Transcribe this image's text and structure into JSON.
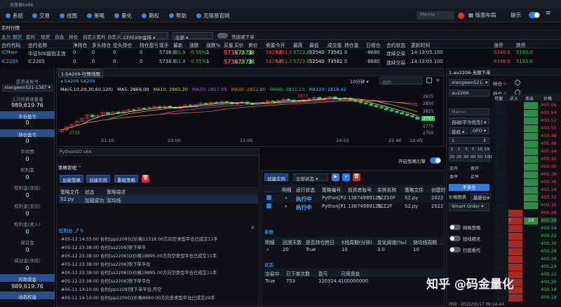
{
  "window": {
    "title": "无限易Kx64"
  },
  "menu": {
    "items": [
      {
        "label": "系统"
      },
      {
        "label": "交易"
      },
      {
        "label": "线图"
      },
      {
        "label": "策略"
      },
      {
        "label": "量化"
      },
      {
        "label": "期权"
      },
      {
        "label": "帮助"
      },
      {
        "label": "无限易官网"
      }
    ],
    "memo_placeholder": "Memo",
    "layout_label": "版面布局",
    "tips_label": "提示"
  },
  "tabs": {
    "realtime": "实时行情",
    "row2": [
      "主力",
      "期货",
      "套利",
      "现货",
      "自选",
      "持仓",
      "自定义套利",
      "自定义指数"
    ],
    "exchange_select": "CFFEX中金所",
    "all_select": "全部",
    "quick_order": "快捷键下单"
  },
  "quote": {
    "headers": [
      "合约代码",
      "合约名称",
      "净持仓",
      "多头持仓",
      "空头持仓",
      "持仓盈亏",
      "现手",
      "最新",
      "涨跌",
      "涨跌%",
      "买量",
      "买价",
      "卖价",
      "卖量",
      "今开",
      "最高",
      "最低",
      "成交量",
      "持仓量",
      "日增仓",
      "合约状态",
      "更新时间",
      "",
      "涨停",
      "跌停"
    ],
    "rows": [
      {
        "code": "ICMain",
        "name": "中证500股指主连",
        "net": "0",
        "long": "0",
        "short": "0",
        "pnl": "0",
        "vol_now": "5738.0",
        "last": "-31.8",
        "chg": "-0.55%",
        "chg_pct": "1",
        "bid_vol": "5736.2",
        "bid": "5737.8",
        "ask": "3",
        "ask_vol": "5829.0",
        "open": "5851.0",
        "high": "5722.6",
        "low": "52540",
        "volume": "73581",
        "oi": "0",
        "oi_chg": "-8680",
        "status": "连续交易",
        "time": "14:13:05.100",
        "limit_up": "6346.6",
        "limit_down": "5193.0"
      },
      {
        "code": "IC2205",
        "name": "IC2205",
        "net": "0",
        "long": "0",
        "short": "0",
        "pnl": "0",
        "vol_now": "5738.0",
        "last": "-31.8",
        "chg": "-0.55%",
        "chg_pct": "1",
        "bid_vol": "5736.2",
        "bid": "5737.8",
        "ask": "3",
        "ask_vol": "5829.0",
        "open": "5851.0",
        "high": "5722.6",
        "low": "52540",
        "volume": "73581",
        "oi": "0",
        "oi_chg": "-8680",
        "status": "连续交易",
        "time": "14:13:05.100",
        "limit_up": "6346.6",
        "limit_down": "5193.0"
      }
    ]
  },
  "account": {
    "label": "投资者账号",
    "id": "xiangwen521-1387",
    "balance_label": "上次结算准备金",
    "balance": "989,619.76",
    "items": [
      {
        "label": "平仓盈亏",
        "value": "0"
      },
      {
        "label": "持仓盈亏",
        "value": "0"
      },
      {
        "label": "手续费",
        "value": "0"
      },
      {
        "label": "权利金",
        "value": "0"
      },
      {
        "label": "权利金(冻结)",
        "value": "0"
      },
      {
        "label": "权利金(支出)",
        "value": "0"
      },
      {
        "label": "权利金(收入)",
        "value": "0"
      },
      {
        "label": "保证金",
        "value": "0"
      },
      {
        "label": "保证金(冻结)",
        "value": "0"
      }
    ],
    "available_label": "可用资金",
    "available": "989,619.76",
    "frozen_label": "动态权益"
  },
  "chart": {
    "tab_title": "1-SA209-行情线图",
    "symbol": "SA209 SA209",
    "period": "10分钟",
    "contract_ph": "合约",
    "ma_label": "MA(5,10,20,30,60,120)",
    "mas": [
      {
        "label": "MA5: 2866.00",
        "color": "#e6e6e6"
      },
      {
        "label": "MA10: 2865.20",
        "color": "#e8c547"
      },
      {
        "label": "MA20: 2857.05",
        "color": "#c452e0"
      },
      {
        "label": "MA30: 2852.80",
        "color": "#e87832"
      },
      {
        "label": "MA60: 2831.13",
        "color": "#2fc25b"
      },
      {
        "label": "MA120: 2818.42",
        "color": "#4db8ff"
      }
    ],
    "y_ticks": [
      "2875",
      "2850",
      "2825",
      "2800",
      "2775",
      "2750"
    ],
    "x_ticks": [
      "21:10",
      "23:00",
      "11:05",
      "14:55",
      "22:40",
      "10:45"
    ],
    "high_mark": "2877",
    "low_mark": "2733",
    "last_tag": "2797",
    "chart_data": {
      "type": "candlestick",
      "symbol": "SA209",
      "ylim": [
        2740,
        2885
      ],
      "ma_labels": [
        "MA5: 2866.00",
        "MA10: 2865.20",
        "MA20: 2857.05",
        "MA30: 2852.80",
        "MA60: 2831.13",
        "MA120: 2818.42"
      ],
      "closes": [
        2760,
        2770,
        2778,
        2790,
        2800,
        2812,
        2805,
        2810,
        2820,
        2815,
        2822,
        2818,
        2825,
        2830,
        2828,
        2835,
        2832,
        2838,
        2840,
        2836,
        2842,
        2838,
        2835,
        2840,
        2846,
        2843,
        2848,
        2852,
        2850,
        2855,
        2852,
        2858,
        2855,
        2850,
        2853,
        2856,
        2851,
        2848,
        2852,
        2855,
        2860,
        2857,
        2862,
        2866,
        2863,
        2858,
        2860,
        2864,
        2868,
        2872,
        2866,
        2870,
        2874,
        2868,
        2865,
        2870,
        2862,
        2858,
        2854,
        2850,
        2845,
        2840,
        2836,
        2830,
        2825,
        2820,
        2815,
        2810,
        2805,
        2797
      ]
    }
  },
  "strategy": {
    "title": "PythonGO x64",
    "manage": "策略管理",
    "load": "加载策略",
    "create": "创建实例",
    "reload": "重载策略",
    "enable_engine": "开启策略引擎",
    "table_headers": [
      "策略文件",
      "状态",
      "策略描述"
    ],
    "rows": [
      {
        "file": "S2.py",
        "state": "加载成功",
        "desc": "双均线"
      }
    ],
    "console_title": "控制台",
    "logs": [
      "#05-13 14:55:00 合约[pp2209]以价格11318.00方向空类型平仓已成交11手",
      "#05-12 23:38:00 合约[ss2206]快下单平",
      "#05-12 23:38:00 合约[ss2206]以价格18895.00方向空类型平仓已成交11手",
      "#05-12 23:38:00 合约[ss2206]快下单平仓",
      "#05-12 23:38:00 合约[ss2206]以价格18885.00方向空类型平仓已成交11手",
      "#05-12 23:38:00 合约[ss2206]快下单平仓",
      "#05-11 14:10:00 合约[pp2209]快下单平仓,开空",
      "#05-11 14:10:00 合约[pp2209]以价格8660.00方向多类型平仓已成交29手"
    ]
  },
  "instance": {
    "create": "创建实例",
    "all": "全部状态",
    "headers": [
      "",
      "明细",
      "运行状态",
      "策略编号",
      "投资者账号",
      "实例名称",
      "策略文件",
      "创建时"
    ],
    "rows": [
      {
        "state": "执行中",
        "no": "Python[P2",
        "acct": "13874989125",
        "name": "S2Z10F",
        "file": "S2.py",
        "ct": "2022"
      },
      {
        "state": "执行中",
        "no": "Python[P1",
        "acct": "13874989125",
        "name": "S2Z2F",
        "file": "S2.py",
        "ct": "2022"
      }
    ],
    "params_title": "参数",
    "param_headers": [
      "明细",
      "回测天数",
      "是否持仓跨日",
      "K线周期(分钟)",
      "变化阈值(‰)",
      "快均线周期"
    ],
    "param_row": [
      "20",
      "True",
      "10",
      "3.0",
      "10"
    ],
    "status_title": "状态",
    "status_headers": [
      "交易中",
      "已下单次数",
      "盈亏",
      "可用资金"
    ],
    "status_row": [
      "True",
      "753",
      "120324.4",
      "100000000"
    ]
  },
  "order": {
    "tab": "1-au2206-无限下单",
    "account": "xiangwen521-",
    "contract": "au2206",
    "pos_long_label": "持仓",
    "pos_short_label": "持仓",
    "memo": "Memo",
    "mode": "自动(平今优先)",
    "price_type": "投机",
    "tif": "GFD",
    "qty": "1",
    "qty_btns": [
      "1",
      "2",
      "3",
      "5",
      "10",
      "15",
      "20",
      "25",
      "30",
      "40",
      "50",
      "100"
    ],
    "buy_label": "买开",
    "sell_label": "卖开",
    "close_long_label": "卖平",
    "close_short_label": "买平",
    "available": "可开:0",
    "flat_btn": "平多仓",
    "price_label": "价格图表",
    "latest": "最新价",
    "smart_order": "Smart Order",
    "toggles": [
      "网格策略",
      "短线精灵",
      "扫盘委托"
    ],
    "ladder_headers": [
      "可撤",
      "买入",
      "卖出",
      "价格"
    ],
    "ladder": [
      {
        "bid": "",
        "ask": "",
        "price": "400.56",
        "hl": "red"
      },
      {
        "bid": "",
        "ask": "",
        "price": "400.54"
      },
      {
        "bid": "",
        "ask": "",
        "price": "400.52"
      },
      {
        "bid": "",
        "ask": "",
        "price": "400.50"
      },
      {
        "bid": "",
        "ask": "",
        "price": "400.48"
      },
      {
        "bid": "",
        "ask": "",
        "price": "400.46"
      },
      {
        "bid": "",
        "ask": "",
        "price": "400.44"
      },
      {
        "bid": "",
        "ask": "",
        "price": "400.42"
      },
      {
        "bid": "",
        "ask": "",
        "price": "400.40"
      },
      {
        "bid": "",
        "ask": "",
        "price": "400.38"
      },
      {
        "bid": "",
        "ask": "",
        "price": "400.36"
      },
      {
        "bid": "",
        "ask": "",
        "price": "400.34"
      },
      {
        "bid": "",
        "ask": "",
        "price": "400.32"
      },
      {
        "bid": "",
        "ask": "",
        "price": "400.30"
      },
      {
        "bid": "",
        "ask": "",
        "price": "400.38"
      },
      {
        "bid": "7",
        "ask": "",
        "price": "400.36"
      },
      {
        "bid": "",
        "ask": "",
        "price": "400.34"
      },
      {
        "bid": "",
        "ask": "",
        "price": "400.32"
      },
      {
        "bid": "",
        "ask": "",
        "price": "400.30"
      },
      {
        "bid": "",
        "ask": "",
        "price": "400.28"
      },
      {
        "bid": "",
        "ask": "",
        "price": "400.26"
      },
      {
        "bid": "",
        "ask": "",
        "price": "400.24"
      },
      {
        "bid": "",
        "ask": "",
        "price": "400.22"
      },
      {
        "bid": "",
        "ask": "",
        "price": "400.20"
      },
      {
        "bid": "",
        "ask": "",
        "price": "400.18"
      },
      {
        "bid": "",
        "ask": "",
        "price": "400.16"
      }
    ],
    "ladder_mark_bid": "7",
    "ladder_mark_ask": "19",
    "footer_time": "时间 : 2022/05/17  09:14:44"
  },
  "watermark": "知乎 @码金量化"
}
